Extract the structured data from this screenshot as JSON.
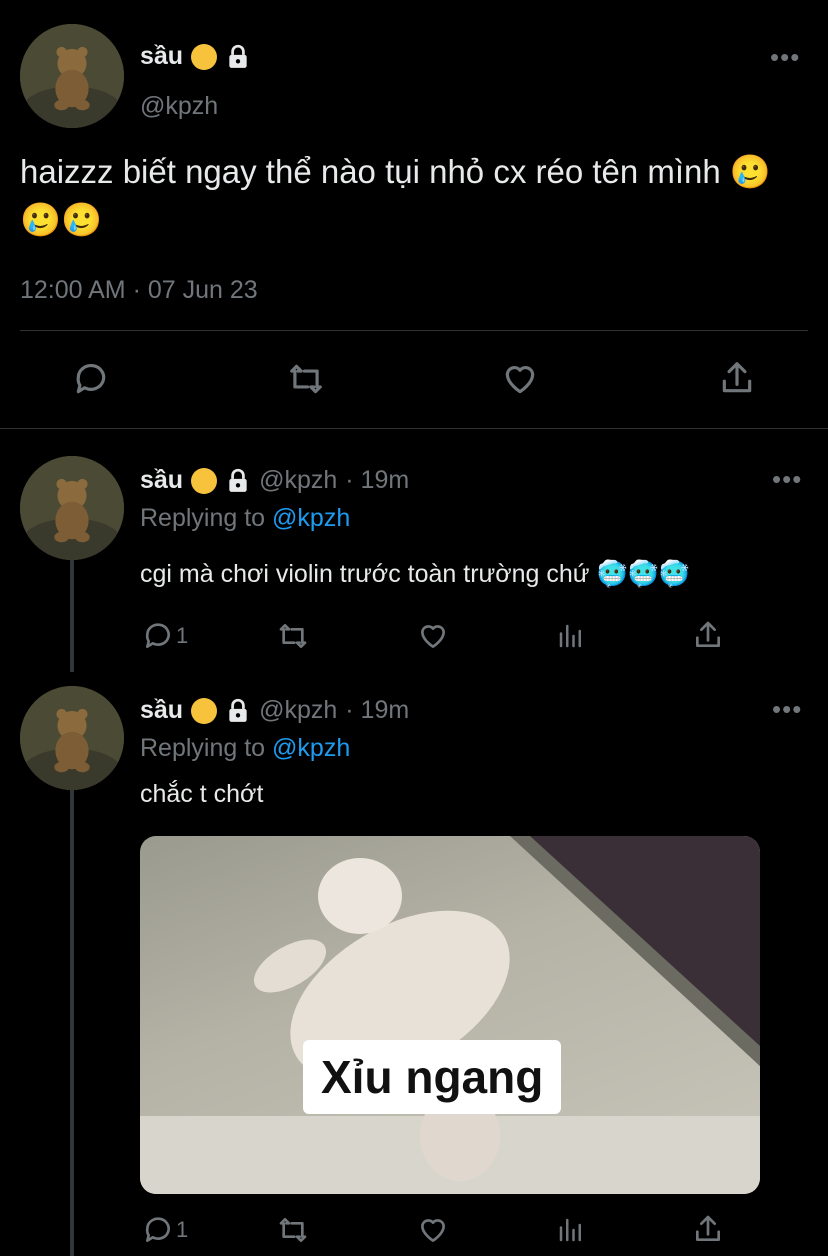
{
  "main_tweet": {
    "display_name": "sầu",
    "handle": "@kpzh",
    "text": "haizzz biết ngay thể nào tụi nhỏ cx réo tên mình 🥲🥲🥲",
    "timestamp": "12:00 AM · 07 Jun 23"
  },
  "reply1": {
    "display_name": "sầu",
    "handle": "@kpzh",
    "time": "· 19m",
    "replying_prefix": "Replying to",
    "replying_handle": "@kpzh",
    "text": "cgi mà chơi violin trước toàn trường chứ 🥶🥶🥶",
    "reply_count": "1"
  },
  "reply2": {
    "display_name": "sầu",
    "handle": "@kpzh",
    "time": "· 19m",
    "replying_prefix": "Replying to",
    "replying_handle": "@kpzh",
    "text": "chắc t chớt",
    "image_caption": "Xỉu ngang",
    "reply_count": "1"
  },
  "colors": {
    "background": "#000000",
    "text": "#e7e9ea",
    "muted": "#71767b",
    "link": "#1d9bf0"
  },
  "icons": [
    "more-icon",
    "lock-icon",
    "melting-face-emoji",
    "reply-icon",
    "retweet-icon",
    "like-icon",
    "share-icon",
    "analytics-icon"
  ]
}
